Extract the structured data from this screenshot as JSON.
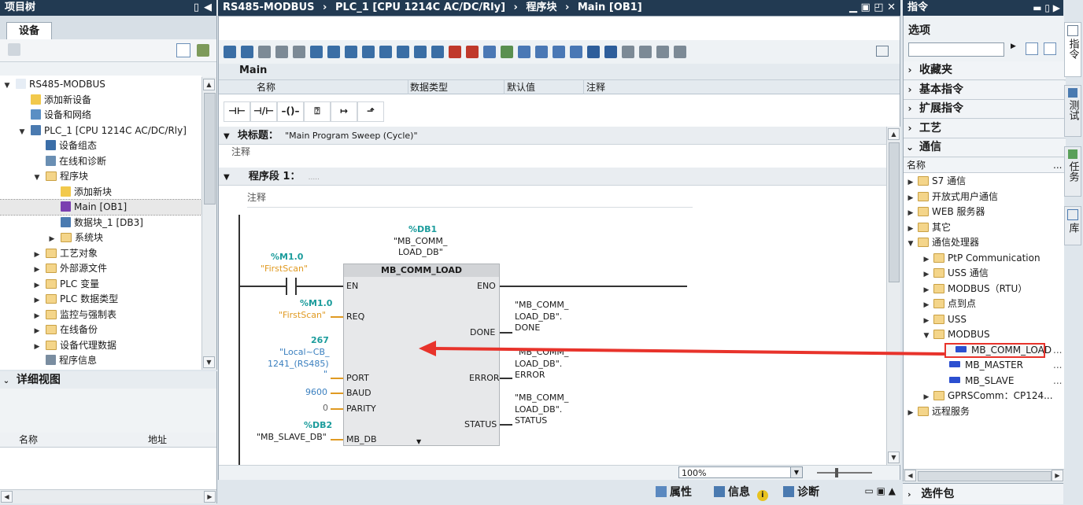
{
  "project_tree": {
    "title": "项目树",
    "tab": "设备",
    "items": [
      {
        "label": "RS485-MODBUS",
        "depth": 0,
        "tw": "▼",
        "icon": "doc"
      },
      {
        "label": "添加新设备",
        "depth": 1,
        "tw": "",
        "icon": "add"
      },
      {
        "label": "设备和网络",
        "depth": 1,
        "tw": "",
        "icon": "net"
      },
      {
        "label": "PLC_1 [CPU 1214C AC/DC/Rly]",
        "depth": 1,
        "tw": "▼",
        "icon": "plc"
      },
      {
        "label": "设备组态",
        "depth": 2,
        "tw": "",
        "icon": "cfg"
      },
      {
        "label": "在线和诊断",
        "depth": 2,
        "tw": "",
        "icon": "diag"
      },
      {
        "label": "程序块",
        "depth": 2,
        "tw": "▼",
        "icon": "folder"
      },
      {
        "label": "添加新块",
        "depth": 3,
        "tw": "",
        "icon": "add"
      },
      {
        "label": "Main [OB1]",
        "depth": 3,
        "tw": "",
        "icon": "ob",
        "selected": true
      },
      {
        "label": "数据块_1 [DB3]",
        "depth": 3,
        "tw": "",
        "icon": "db"
      },
      {
        "label": "系统块",
        "depth": 3,
        "tw": "▶",
        "icon": "folder"
      },
      {
        "label": "工艺对象",
        "depth": 2,
        "tw": "▶",
        "icon": "folder"
      },
      {
        "label": "外部源文件",
        "depth": 2,
        "tw": "▶",
        "icon": "folder"
      },
      {
        "label": "PLC 变量",
        "depth": 2,
        "tw": "▶",
        "icon": "folder"
      },
      {
        "label": "PLC 数据类型",
        "depth": 2,
        "tw": "▶",
        "icon": "folder"
      },
      {
        "label": "监控与强制表",
        "depth": 2,
        "tw": "▶",
        "icon": "folder"
      },
      {
        "label": "在线备份",
        "depth": 2,
        "tw": "▶",
        "icon": "folder"
      },
      {
        "label": "设备代理数据",
        "depth": 2,
        "tw": "▶",
        "icon": "folder"
      },
      {
        "label": "程序信息",
        "depth": 2,
        "tw": "",
        "icon": "info"
      }
    ]
  },
  "detail_view": {
    "title": "详细视图",
    "col_name": "名称",
    "col_addr": "地址"
  },
  "editor": {
    "breadcrumb": [
      "RS485-MODBUS",
      "PLC_1 [CPU 1214C AC/DC/Rly]",
      "程序块",
      "Main [OB1]"
    ],
    "interface_title": "Main",
    "interface_cols": [
      "名称",
      "数据类型",
      "默认值",
      "注释"
    ],
    "block_title_label": "块标题：",
    "block_title_value": "\"Main Program Sweep (Cycle)\"",
    "comment": "注释",
    "network_label": "程序段 1：",
    "network_dots": ".....",
    "network_comment": "注释",
    "zoom": "100%"
  },
  "ladder": {
    "db_addr": "%DB1",
    "db_name1": "\"MB_COMM_",
    "db_name2": "LOAD_DB\"",
    "block_name": "MB_COMM_LOAD",
    "contact_addr": "%M1.0",
    "contact_name": "\"FirstScan\"",
    "pin_en": "EN",
    "pin_eno": "ENO",
    "req_addr": "%M1.0",
    "req_name": "\"FirstScan\"",
    "pin_req": "REQ",
    "port_val": "267",
    "port_name1": "\"Local~CB_",
    "port_name2": "1241_(RS485)",
    "port_name3": "\"",
    "pin_port": "PORT",
    "baud_val": "9600",
    "pin_baud": "BAUD",
    "parity_val": "0",
    "pin_parity": "PARITY",
    "mbdb_addr": "%DB2",
    "mbdb_name": "\"MB_SLAVE_DB\"",
    "pin_mbdb": "MB_DB",
    "pin_done": "DONE",
    "pin_error": "ERROR",
    "pin_status": "STATUS",
    "out_done": [
      "\"MB_COMM_",
      "LOAD_DB\".",
      "DONE"
    ],
    "out_error": [
      "\"MB_COMM_",
      "LOAD_DB\".",
      "ERROR"
    ],
    "out_status": [
      "\"MB_COMM_",
      "LOAD_DB\".",
      "STATUS"
    ]
  },
  "instructions": {
    "title": "指令",
    "options": "选项",
    "categories": [
      "收藏夹",
      "基本指令",
      "扩展指令",
      "工艺",
      "通信"
    ],
    "col_name": "名称",
    "tree": [
      {
        "label": "S7 通信",
        "depth": 0,
        "tw": "▶",
        "icon": "folder"
      },
      {
        "label": "开放式用户通信",
        "depth": 0,
        "tw": "▶",
        "icon": "folder"
      },
      {
        "label": "WEB 服务器",
        "depth": 0,
        "tw": "▶",
        "icon": "folder"
      },
      {
        "label": "其它",
        "depth": 0,
        "tw": "▶",
        "icon": "folder"
      },
      {
        "label": "通信处理器",
        "depth": 0,
        "tw": "▼",
        "icon": "folder"
      },
      {
        "label": "PtP Communication",
        "depth": 1,
        "tw": "▶",
        "icon": "folder"
      },
      {
        "label": "USS 通信",
        "depth": 1,
        "tw": "▶",
        "icon": "folder"
      },
      {
        "label": "MODBUS（RTU）",
        "depth": 1,
        "tw": "▶",
        "icon": "folder"
      },
      {
        "label": "点到点",
        "depth": 1,
        "tw": "▶",
        "icon": "folder"
      },
      {
        "label": "USS",
        "depth": 1,
        "tw": "▶",
        "icon": "folder"
      },
      {
        "label": "MODBUS",
        "depth": 1,
        "tw": "▼",
        "icon": "folder"
      },
      {
        "label": "MB_COMM_LOAD",
        "depth": 2,
        "tw": "",
        "icon": "fb",
        "highlight": true
      },
      {
        "label": "MB_MASTER",
        "depth": 2,
        "tw": "",
        "icon": "fb"
      },
      {
        "label": "MB_SLAVE",
        "depth": 2,
        "tw": "",
        "icon": "fb"
      },
      {
        "label": "GPRSComm：CP124...",
        "depth": 1,
        "tw": "▶",
        "icon": "folder"
      },
      {
        "label": "远程服务",
        "depth": 0,
        "tw": "▶",
        "icon": "folder"
      }
    ],
    "bottom": "选件包"
  },
  "side_tabs": [
    "指令",
    "测试",
    "任务",
    "库"
  ],
  "status_bar": {
    "properties": "属性",
    "info": "信息",
    "diagnostics": "诊断"
  }
}
